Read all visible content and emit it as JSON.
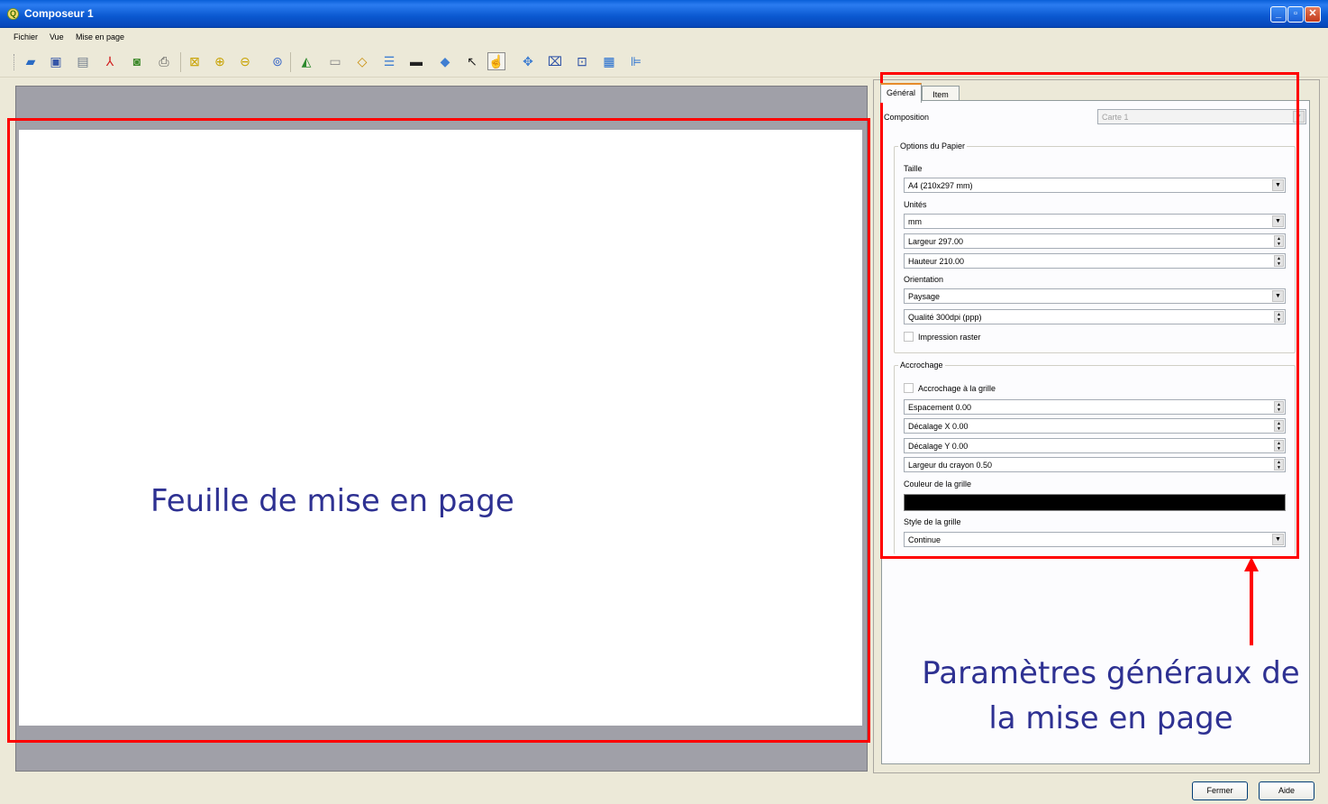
{
  "window": {
    "title": "Composeur 1",
    "app_icon_letter": "Q"
  },
  "menu": [
    "Fichier",
    "Vue",
    "Mise en page"
  ],
  "toolbar": {
    "icons": [
      "open-icon",
      "save-icon",
      "export-image-icon",
      "export-pdf-icon",
      "export-svg-icon",
      "print-icon",
      "zoom-full-icon",
      "zoom-in-icon",
      "zoom-out-icon",
      "refresh-icon",
      "add-map-icon",
      "add-image-icon",
      "add-label-icon",
      "add-legend-icon",
      "add-scalebar-icon",
      "add-shape-icon",
      "add-arrow-icon",
      "select-move-icon",
      "move-content-icon",
      "group-icon",
      "ungroup-icon",
      "raise-icon",
      "align-icon"
    ]
  },
  "canvas": {
    "annotation": "Feuille de mise en page"
  },
  "panel": {
    "tabs": [
      "Général",
      "Item"
    ],
    "composition_label": "Composition",
    "composition_value": "Carte 1",
    "paper_group": {
      "title": "Options du Papier",
      "taille_label": "Taille",
      "taille_value": "A4 (210x297 mm)",
      "unites_label": "Unités",
      "unites_value": "mm",
      "largeur": "Largeur 297.00",
      "hauteur": "Hauteur 210.00",
      "orientation_label": "Orientation",
      "orientation_value": "Paysage",
      "qualite": "Qualité 300dpi (ppp)",
      "raster_label": "Impression raster",
      "raster_checked": false
    },
    "snap_group": {
      "title": "Accrochage",
      "snap_label": "Accrochage à la grille",
      "snap_checked": false,
      "espacement": "Espacement 0.00",
      "decalage_x": "Décalage X 0.00",
      "decalage_y": "Décalage Y 0.00",
      "largeur_crayon": "Largeur du crayon 0.50",
      "couleur_label": "Couleur de la grille",
      "couleur_value": "#000000",
      "style_label": "Style de la grille",
      "style_value": "Continue"
    },
    "annotation": "Paramètres généraux de la mise en page"
  },
  "footer": {
    "close_label": "Fermer",
    "help_label": "Aide"
  },
  "colors": {
    "title_bar": "#0a58d0",
    "annotation_frame": "#ff0000",
    "annotation_text": "#2e3192"
  }
}
